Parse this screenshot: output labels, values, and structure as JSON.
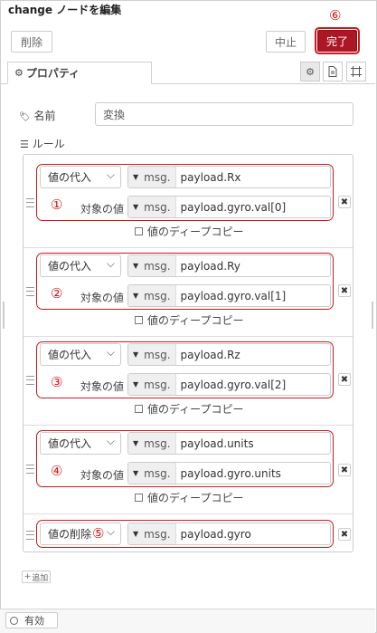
{
  "header": {
    "title": "change ノードを編集",
    "delete_label": "削除",
    "cancel_label": "中止",
    "done_label": "完了",
    "done_marker": "⑥"
  },
  "tabs": {
    "properties_label": "プロパティ",
    "icons": [
      "gear-icon",
      "document-icon",
      "frame-icon"
    ]
  },
  "form": {
    "name_label": "名前",
    "name_value": "変換",
    "rules_label": "ルール"
  },
  "rules": [
    {
      "action": "値の代入",
      "prefix": "msg.",
      "property": "payload.Rx",
      "target_label": "対象の値",
      "target_prefix": "msg.",
      "target_value": "payload.gyro.val[0]",
      "deep_copy": "値のディープコピー",
      "marker": "①"
    },
    {
      "action": "値の代入",
      "prefix": "msg.",
      "property": "payload.Ry",
      "target_label": "対象の値",
      "target_prefix": "msg.",
      "target_value": "payload.gyro.val[1]",
      "deep_copy": "値のディープコピー",
      "marker": "②"
    },
    {
      "action": "値の代入",
      "prefix": "msg.",
      "property": "payload.Rz",
      "target_label": "対象の値",
      "target_prefix": "msg.",
      "target_value": "payload.gyro.val[2]",
      "deep_copy": "値のディープコピー",
      "marker": "③"
    },
    {
      "action": "値の代入",
      "prefix": "msg.",
      "property": "payload.units",
      "target_label": "対象の値",
      "target_prefix": "msg.",
      "target_value": "payload.gyro.units",
      "deep_copy": "値のディープコピー",
      "marker": "④"
    },
    {
      "action": "値の削除",
      "prefix": "msg.",
      "property": "payload.gyro",
      "marker": "⑤"
    }
  ],
  "add_label": "追加",
  "footer": {
    "enabled_label": "有効"
  },
  "colors": {
    "accent": "#ad1625",
    "annotation": "#d01818"
  }
}
